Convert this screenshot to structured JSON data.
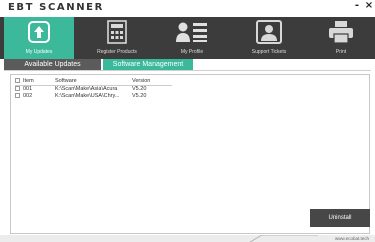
{
  "window": {
    "title": "EBT SCANNER",
    "minimize": "-",
    "close": "×"
  },
  "toolbar": {
    "items": [
      {
        "label": "My Updates",
        "icon": "upload-icon"
      },
      {
        "label": "Register Products",
        "icon": "calculator-icon"
      },
      {
        "label": "My Profile",
        "icon": "profile-icon"
      },
      {
        "label": "Support Tickets",
        "icon": "support-icon"
      },
      {
        "label": "Print",
        "icon": "printer-icon"
      }
    ]
  },
  "tabs": {
    "available": "Available Updates",
    "software": "Software Management"
  },
  "table": {
    "headers": [
      "Item",
      "Software",
      "Version"
    ],
    "rows": [
      {
        "item": "001",
        "software": "K:\\Scan\\Make\\Asia\\Acura",
        "version": "V5.20"
      },
      {
        "item": "002",
        "software": "K:\\Scan\\Make\\USA\\Chry...",
        "version": "V5.20"
      }
    ]
  },
  "buttons": {
    "uninstall": "Uninstall"
  },
  "status": {
    "url": "www.ecobat.tech"
  },
  "colors": {
    "accent": "#3cb89a",
    "toolbar": "#3c3c3c",
    "tab_inactive": "#5b5b5b",
    "button": "#474747"
  }
}
